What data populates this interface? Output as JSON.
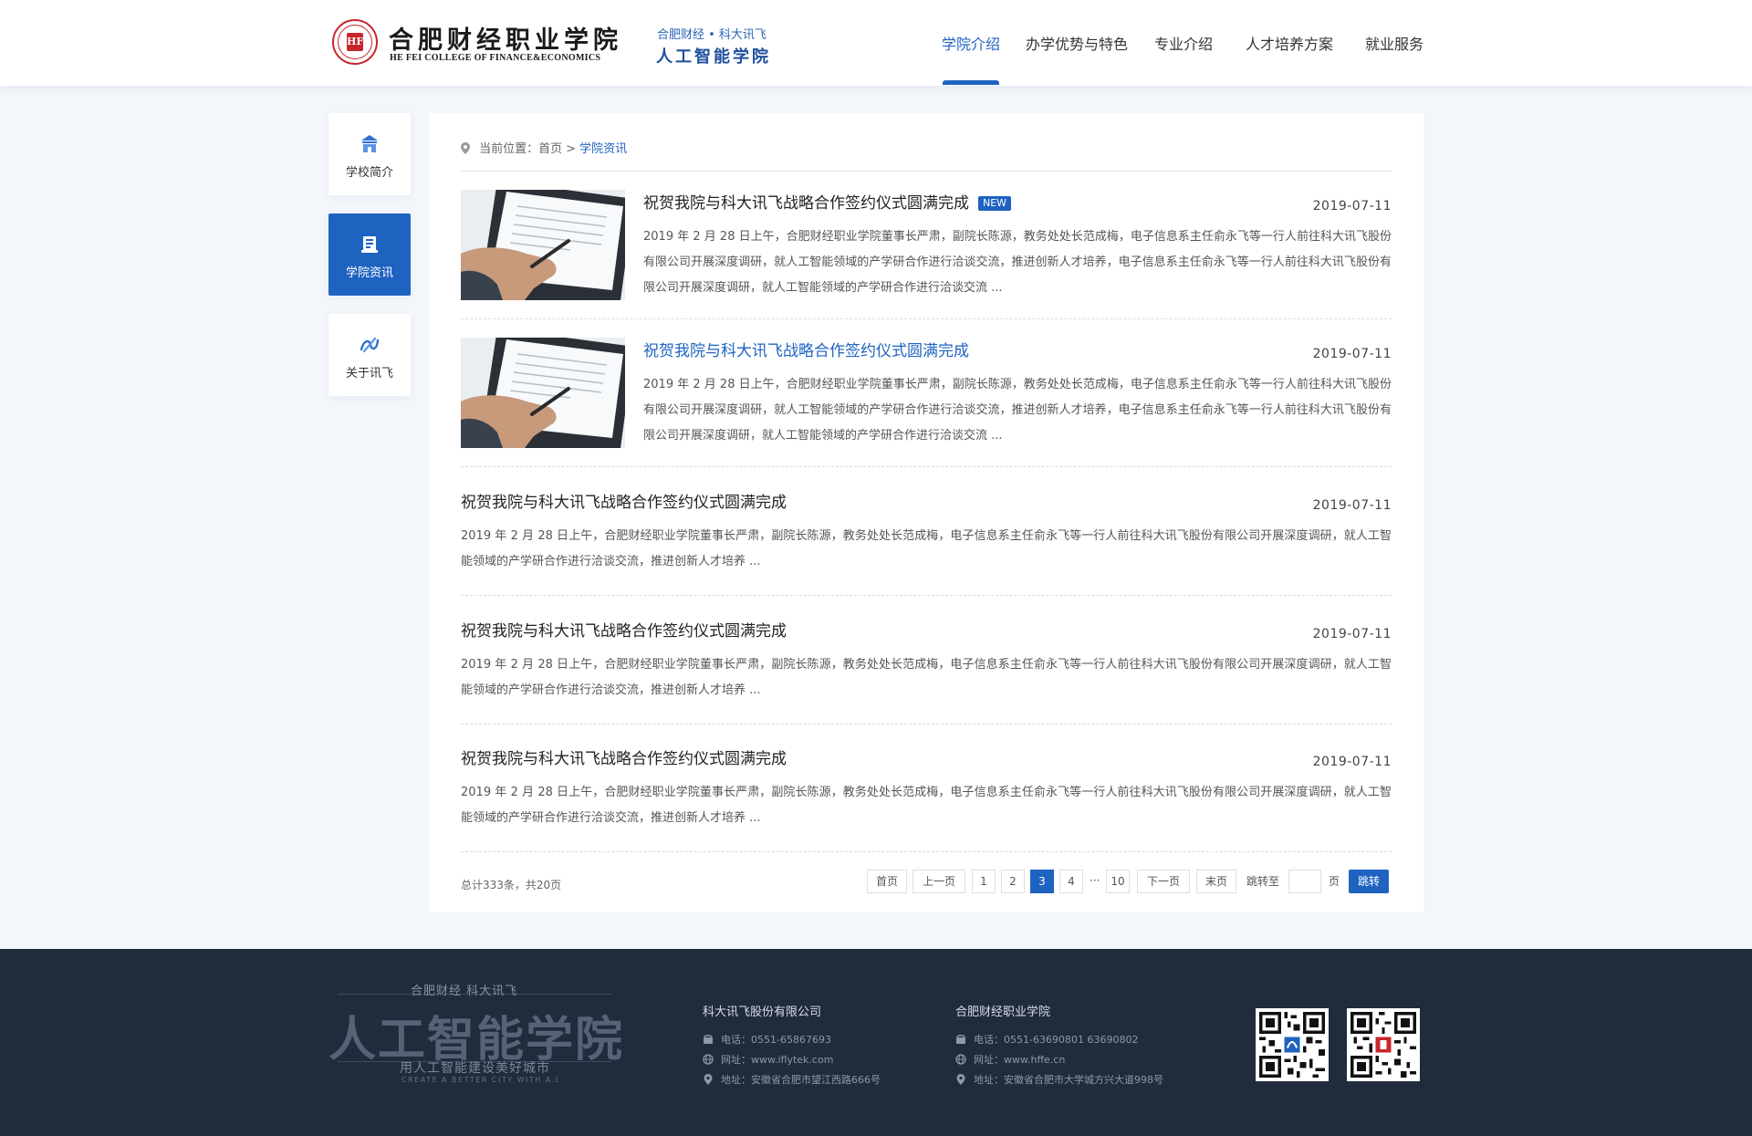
{
  "header": {
    "logo_mark": "HF",
    "college_cn": "合肥财经职业学院",
    "college_en": "HE FEI COLLEGE OF FINANCE&ECONOMICS",
    "sub_line1": "合肥财经 • 科大讯飞",
    "sub_line2": "人工智能学院",
    "nav": [
      {
        "label": "学院介绍",
        "active": true
      },
      {
        "label": "办学优势与特色",
        "active": false
      },
      {
        "label": "专业介绍",
        "active": false
      },
      {
        "label": "人才培养方案",
        "active": false
      },
      {
        "label": "就业服务",
        "active": false
      }
    ]
  },
  "sidebar": {
    "items": [
      {
        "label": "学校简介",
        "icon": "school-icon",
        "active": false
      },
      {
        "label": "学院资讯",
        "icon": "book-icon",
        "active": true
      },
      {
        "label": "关于讯飞",
        "icon": "iflytek-icon",
        "active": false
      }
    ]
  },
  "breadcrumb": {
    "prefix": "当前位置：",
    "home": "首页",
    "separator": ">",
    "current": "学院资讯"
  },
  "news": [
    {
      "title": "祝贺我院与科大讯飞战略合作签约仪式圆满完成",
      "badge": "NEW",
      "date": "2019-07-11",
      "has_thumb": true,
      "desc": "2019 年 2 月 28 日上午，合肥财经职业学院董事长严肃，副院长陈源，教务处处长范成梅，电子信息系主任俞永飞等一行人前往科大讯飞股份有限公司开展深度调研，就人工智能领域的产学研合作进行洽谈交流，推进创新人才培养，电子信息系主任俞永飞等一行人前往科大讯飞股份有限公司开展深度调研，就人工智能领域的产学研合作进行洽谈交流 ..."
    },
    {
      "title": "祝贺我院与科大讯飞战略合作签约仪式圆满完成",
      "badge": "",
      "date": "2019-07-11",
      "has_thumb": true,
      "desc": "2019 年 2 月 28 日上午，合肥财经职业学院董事长严肃，副院长陈源，教务处处长范成梅，电子信息系主任俞永飞等一行人前往科大讯飞股份有限公司开展深度调研，就人工智能领域的产学研合作进行洽谈交流，推进创新人才培养，电子信息系主任俞永飞等一行人前往科大讯飞股份有限公司开展深度调研，就人工智能领域的产学研合作进行洽谈交流 ..."
    },
    {
      "title": "祝贺我院与科大讯飞战略合作签约仪式圆满完成",
      "badge": "",
      "date": "2019-07-11",
      "has_thumb": false,
      "desc": "2019 年 2 月 28 日上午，合肥财经职业学院董事长严肃，副院长陈源，教务处处长范成梅，电子信息系主任俞永飞等一行人前往科大讯飞股份有限公司开展深度调研，就人工智能领域的产学研合作进行洽谈交流，推进创新人才培养 ..."
    },
    {
      "title": "祝贺我院与科大讯飞战略合作签约仪式圆满完成",
      "badge": "",
      "date": "2019-07-11",
      "has_thumb": false,
      "desc": "2019 年 2 月 28 日上午，合肥财经职业学院董事长严肃，副院长陈源，教务处处长范成梅，电子信息系主任俞永飞等一行人前往科大讯飞股份有限公司开展深度调研，就人工智能领域的产学研合作进行洽谈交流，推进创新人才培养 ..."
    },
    {
      "title": "祝贺我院与科大讯飞战略合作签约仪式圆满完成",
      "badge": "",
      "date": "2019-07-11",
      "has_thumb": false,
      "desc": "2019 年 2 月 28 日上午，合肥财经职业学院董事长严肃，副院长陈源，教务处处长范成梅，电子信息系主任俞永飞等一行人前往科大讯飞股份有限公司开展深度调研，就人工智能领域的产学研合作进行洽谈交流，推进创新人才培养 ..."
    }
  ],
  "pagination": {
    "total_text": "总计333条，共20页",
    "first": "首页",
    "prev": "上一页",
    "pages": [
      "1",
      "2",
      "3",
      "4"
    ],
    "current": "3",
    "ellipsis": "···",
    "last_page": "10",
    "next": "下一页",
    "last": "末页",
    "jump_label": "跳转至",
    "page_unit": "页",
    "go": "跳转"
  },
  "footer": {
    "brand_top": "合肥财经  科大讯飞",
    "brand_main": "人工智能学院",
    "brand_slogan": "用人工智能建设美好城市",
    "brand_en": "CREATE A BETTER CITY WITH A.I.",
    "col1": {
      "title": "科大讯飞股份有限公司",
      "phone": "电话：0551-65867693",
      "web": "网址：www.iflytek.com",
      "addr": "地址：安徽省合肥市望江西路666号"
    },
    "col2": {
      "title": "合肥财经职业学院",
      "phone": "电话：0551-63690801  63690802",
      "web": "网址：www.hffe.cn",
      "addr": "地址：安徽省合肥市大学城方兴大道998号"
    }
  },
  "colors": {
    "accent": "#1f63c1",
    "footer_bg": "#202b3c",
    "page_bg": "#f3f6fb"
  }
}
